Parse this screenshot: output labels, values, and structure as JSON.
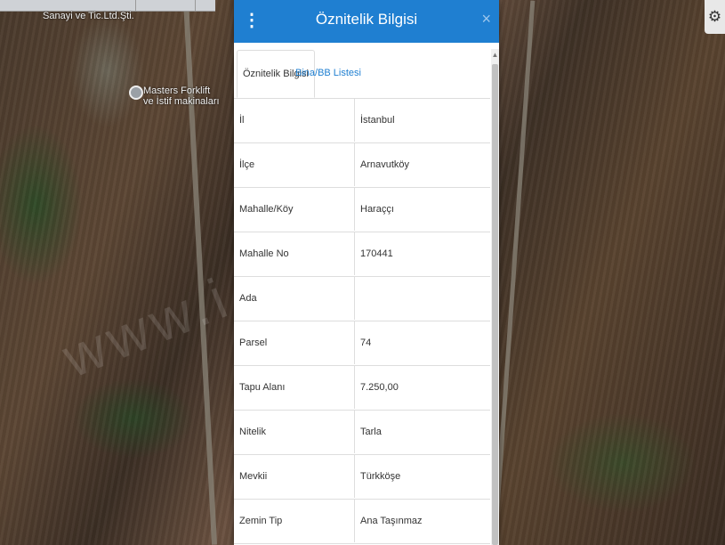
{
  "map": {
    "labels": {
      "company": "Sanayi ve Tic.Ltd.Şti.",
      "poi": "Masters Forklift\nve İstif makinaları"
    },
    "watermark": "www.i                         .net.tr",
    "settings_icon": "gear-icon",
    "colors": {
      "header": "#1f7fd1"
    }
  },
  "panel": {
    "menu_glyph": "⋮",
    "title": "Öznitelik Bilgisi",
    "close_glyph": "×",
    "tabs": [
      {
        "label": "Öznitelik Bilgisi",
        "active": true
      },
      {
        "label": "Bina/BB Listesi",
        "active": false
      }
    ],
    "rows": [
      {
        "key": "İl",
        "value": "İstanbul"
      },
      {
        "key": "İlçe",
        "value": "Arnavutköy"
      },
      {
        "key": "Mahalle/Köy",
        "value": "Haraççı"
      },
      {
        "key": "Mahalle No",
        "value": "170441"
      },
      {
        "key": "Ada",
        "value": ""
      },
      {
        "key": "Parsel",
        "value": "74"
      },
      {
        "key": "Tapu Alanı",
        "value": "7.250,00"
      },
      {
        "key": "Nitelik",
        "value": "Tarla"
      },
      {
        "key": "Mevkii",
        "value": "Türkköşe"
      },
      {
        "key": "Zemin Tip",
        "value": "Ana Taşınmaz"
      }
    ]
  }
}
